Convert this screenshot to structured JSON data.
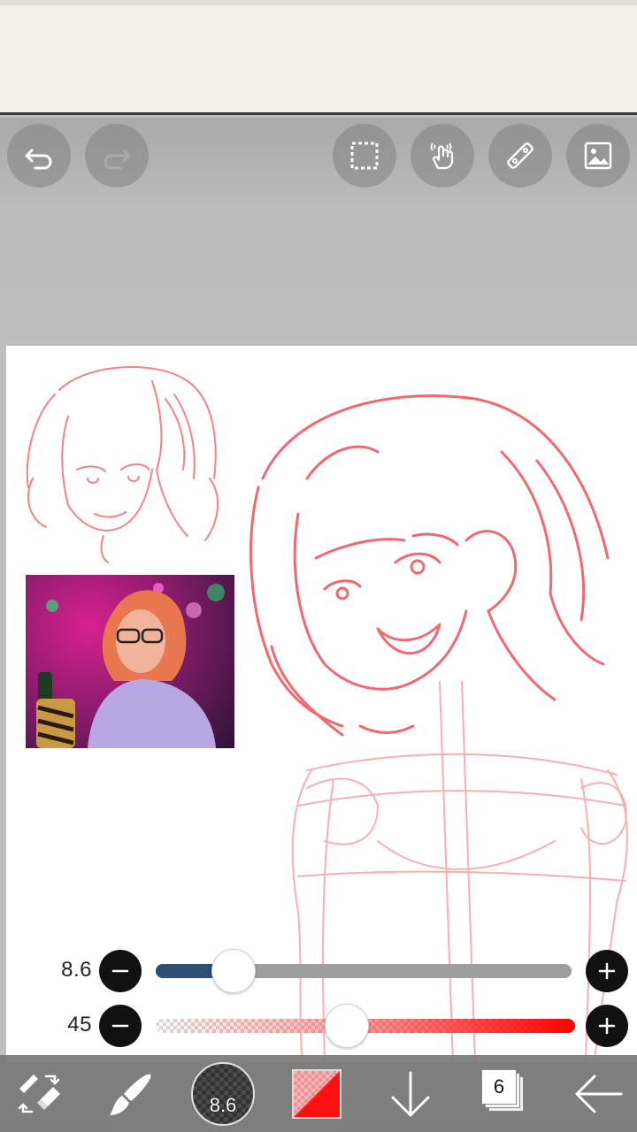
{
  "toolbar": {
    "buttons": [
      {
        "icon": "undo-icon"
      },
      {
        "icon": "redo-icon"
      },
      {
        "icon": "selection-icon"
      },
      {
        "icon": "hand-icon"
      },
      {
        "icon": "ruler-icon"
      },
      {
        "icon": "image-icon"
      }
    ]
  },
  "sliders": {
    "brush_size": {
      "value": "8.6",
      "level": 0.15
    },
    "opacity": {
      "value": "45",
      "level": 0.45
    }
  },
  "bottom": {
    "brush_size_label": "8.6",
    "layer_count": "6",
    "color": "#ff1010"
  },
  "colors": {
    "sketch": "#ef4f57",
    "slider_fill": "#2f4d75",
    "accent_red": "#ff0000"
  }
}
